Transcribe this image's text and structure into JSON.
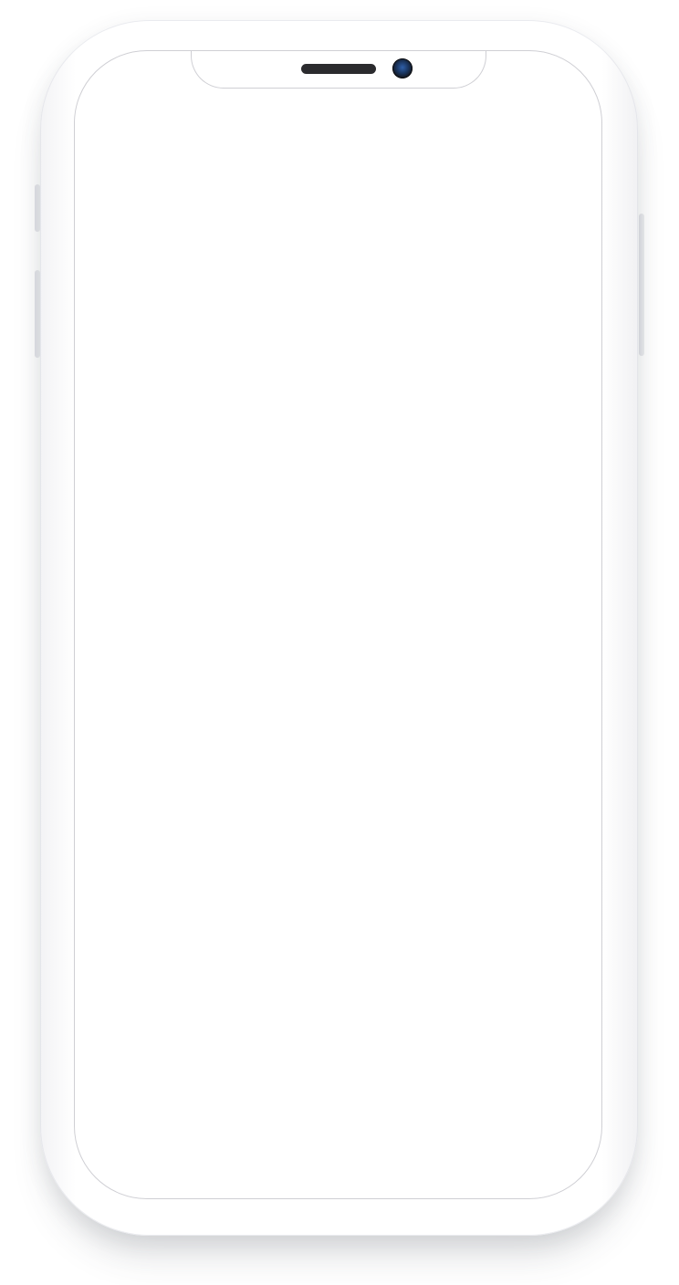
{
  "device": {
    "type": "smartphone-mockup",
    "frame_color": "#ffffff",
    "screen_color": "#ffffff",
    "outline_color": "#cfcfd4",
    "speaker_color": "#2b2b2e",
    "camera_color": "#1a355f"
  },
  "screen": {
    "content": ""
  }
}
